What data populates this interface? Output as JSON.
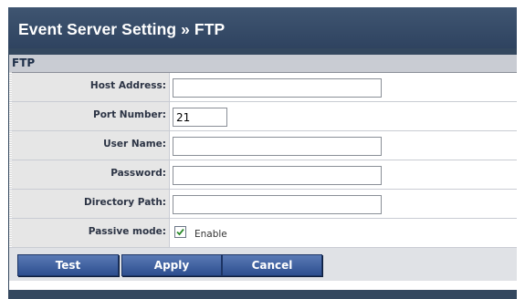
{
  "title": "Event Server Setting » FTP",
  "section": {
    "title": "FTP"
  },
  "fields": {
    "host_address": {
      "label": "Host Address:",
      "value": ""
    },
    "port_number": {
      "label": "Port Number:",
      "value": "21"
    },
    "user_name": {
      "label": "User Name:",
      "value": ""
    },
    "password": {
      "label": "Password:",
      "value": ""
    },
    "directory_path": {
      "label": "Directory Path:",
      "value": ""
    },
    "passive_mode": {
      "label": "Passive mode:",
      "checkbox_label": "Enable",
      "checked": true
    }
  },
  "buttons": {
    "test": "Test",
    "apply": "Apply",
    "cancel": "Cancel"
  },
  "colors": {
    "panel": "#34485f",
    "button": "#3a5c9f"
  }
}
